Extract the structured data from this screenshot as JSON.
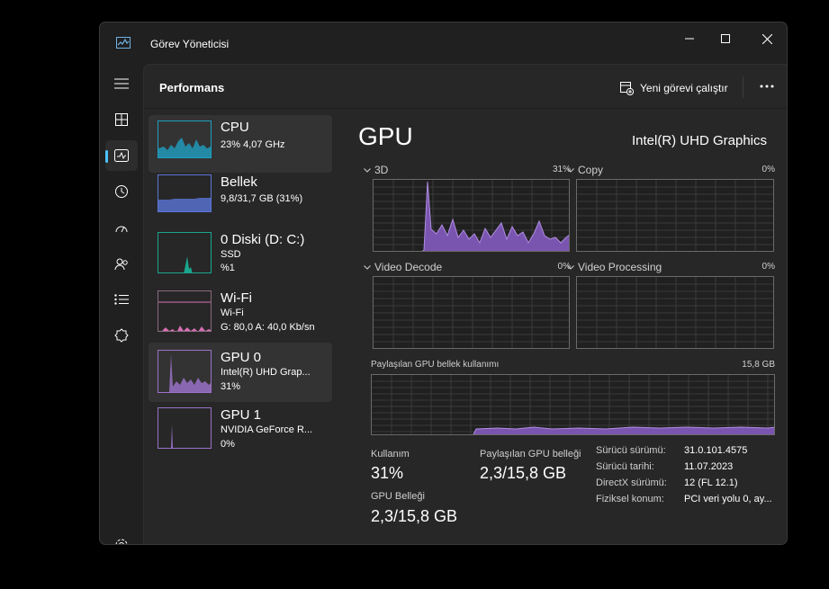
{
  "window": {
    "title": "Görev Yöneticisi"
  },
  "header": {
    "title": "Performans",
    "run_task": "Yeni görevi çalıştır"
  },
  "colors": {
    "cpu": "#1f9fc0",
    "memory": "#5b76d8",
    "disk": "#1aa68d",
    "wifi": "#d66fb2",
    "gpu": "#9a72c8",
    "accent": "#4cc2ff"
  },
  "nav": {
    "icons": [
      "hamburger-icon",
      "processes-icon",
      "performance-icon",
      "app-history-icon",
      "startup-apps-icon",
      "users-icon",
      "details-icon",
      "services-icon",
      "settings-icon"
    ]
  },
  "sidebar": {
    "items": [
      {
        "title": "CPU",
        "lines": [
          "23%  4,07 GHz"
        ]
      },
      {
        "title": "Bellek",
        "lines": [
          "9,8/31,7 GB (31%)"
        ]
      },
      {
        "title": "0 Diski (D: C:)",
        "lines": [
          "SSD",
          "%1"
        ]
      },
      {
        "title": "Wi-Fi",
        "lines": [
          "Wi-Fi",
          "G: 80,0  A: 40,0 Kb/sn"
        ]
      },
      {
        "title": "GPU 0",
        "lines": [
          "Intel(R) UHD Grap...",
          "31%"
        ]
      },
      {
        "title": "GPU 1",
        "lines": [
          "NVIDIA GeForce R...",
          "0%"
        ]
      }
    ]
  },
  "main": {
    "title": "GPU",
    "model": "Intel(R) UHD Graphics",
    "engines": [
      {
        "name": "3D",
        "percent": "31%"
      },
      {
        "name": "Copy",
        "percent": "0%"
      },
      {
        "name": "Video Decode",
        "percent": "0%"
      },
      {
        "name": "Video Processing",
        "percent": "0%"
      }
    ],
    "shared_memory": {
      "label": "Paylaşılan GPU bellek kullanımı",
      "max": "15,8 GB"
    },
    "stats": {
      "usage_label": "Kullanım",
      "usage_value": "31%",
      "shared_label": "Paylaşılan GPU belleği",
      "shared_value": "2,3/15,8 GB",
      "gpu_mem_label": "GPU Belleği",
      "gpu_mem_value": "2,3/15,8 GB"
    },
    "info": [
      {
        "key": "Sürücü sürümü:",
        "value": "31.0.101.4575"
      },
      {
        "key": "Sürücü tarihi:",
        "value": "11.07.2023"
      },
      {
        "key": "DirectX sürümü:",
        "value": "12 (FL 12.1)"
      },
      {
        "key": "Fiziksel konum:",
        "value": "PCI veri yolu 0, ay..."
      }
    ]
  }
}
